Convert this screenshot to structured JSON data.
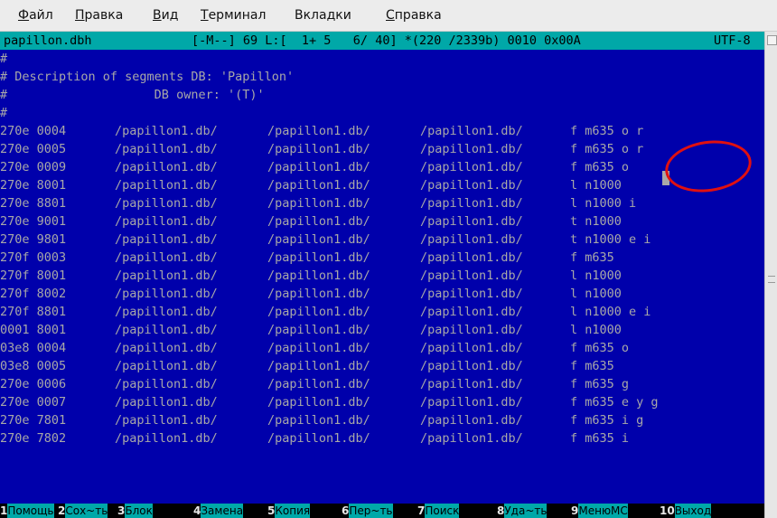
{
  "menu": [
    {
      "label": "Файл",
      "underline": "Ф",
      "rest": "айл"
    },
    {
      "label": "Правка",
      "underline": "П",
      "rest": "равка"
    },
    {
      "label": "Вид",
      "underline": "В",
      "rest": "ид"
    },
    {
      "label": "Терминал",
      "underline": "Т",
      "rest": "ерминал"
    },
    {
      "label": "Вкладки",
      "underline": "",
      "rest": "Вкладки"
    },
    {
      "label": "Справка",
      "underline": "С",
      "rest": "правка"
    }
  ],
  "status": {
    "filename": "papillon.dbh",
    "mode": "[-M--] 69 L:[  1+ 5   6/ 40] *(220 /2339b) 0010 0x00A",
    "encoding": "UTF-8"
  },
  "header_lines": [
    "#",
    "# Description of segments DB: 'Papillon'",
    "#                    DB owner: '(T)'",
    "#"
  ],
  "rows": [
    {
      "id": "270e 0004",
      "p1": "/papillon1.db/",
      "p2": "/papillon1.db/",
      "p3": "/papillon1.db/",
      "attr": "f m635 o r"
    },
    {
      "id": "270e 0005",
      "p1": "/papillon1.db/",
      "p2": "/papillon1.db/",
      "p3": "/papillon1.db/",
      "attr": "f m635 o r"
    },
    {
      "id": "270e 0009",
      "p1": "/papillon1.db/",
      "p2": "/papillon1.db/",
      "p3": "/papillon1.db/",
      "attr": "f m635 o"
    },
    {
      "id": "270e 8001",
      "p1": "/papillon1.db/",
      "p2": "/papillon1.db/",
      "p3": "/papillon1.db/",
      "attr": "l n1000"
    },
    {
      "id": "270e 8801",
      "p1": "/papillon1.db/",
      "p2": "/papillon1.db/",
      "p3": "/papillon1.db/",
      "attr": "l n1000 i"
    },
    {
      "id": "270e 9001",
      "p1": "/papillon1.db/",
      "p2": "/papillon1.db/",
      "p3": "/papillon1.db/",
      "attr": "t n1000"
    },
    {
      "id": "270e 9801",
      "p1": "/papillon1.db/",
      "p2": "/papillon1.db/",
      "p3": "/papillon1.db/",
      "attr": "t n1000 e i"
    },
    {
      "id": "270f 0003",
      "p1": "/papillon1.db/",
      "p2": "/papillon1.db/",
      "p3": "/papillon1.db/",
      "attr": "f m635"
    },
    {
      "id": "270f 8001",
      "p1": "/papillon1.db/",
      "p2": "/papillon1.db/",
      "p3": "/papillon1.db/",
      "attr": "l n1000"
    },
    {
      "id": "270f 8002",
      "p1": "/papillon1.db/",
      "p2": "/papillon1.db/",
      "p3": "/papillon1.db/",
      "attr": "l n1000"
    },
    {
      "id": "270f 8801",
      "p1": "/papillon1.db/",
      "p2": "/papillon1.db/",
      "p3": "/papillon1.db/",
      "attr": "l n1000 e i"
    },
    {
      "id": "0001 8001",
      "p1": "/papillon1.db/",
      "p2": "/papillon1.db/",
      "p3": "/papillon1.db/",
      "attr": "l n1000"
    },
    {
      "id": "03e8 0004",
      "p1": "/papillon1.db/",
      "p2": "/papillon1.db/",
      "p3": "/papillon1.db/",
      "attr": "f m635 o"
    },
    {
      "id": "03e8 0005",
      "p1": "/papillon1.db/",
      "p2": "/papillon1.db/",
      "p3": "/papillon1.db/",
      "attr": "f m635"
    },
    {
      "id": "270e 0006",
      "p1": "/papillon1.db/",
      "p2": "/papillon1.db/",
      "p3": "/papillon1.db/",
      "attr": "f m635 g"
    },
    {
      "id": "270e 0007",
      "p1": "/papillon1.db/",
      "p2": "/papillon1.db/",
      "p3": "/papillon1.db/",
      "attr": "f m635 e y g"
    },
    {
      "id": "270e 7801",
      "p1": "/papillon1.db/",
      "p2": "/papillon1.db/",
      "p3": "/papillon1.db/",
      "attr": "f m635 i g"
    },
    {
      "id": "270e 7802",
      "p1": "/papillon1.db/",
      "p2": "/papillon1.db/",
      "p3": "/papillon1.db/",
      "attr": "f m635 i"
    }
  ],
  "fkeys": [
    {
      "num": "1",
      "label": "Помощь"
    },
    {
      "num": "2",
      "label": "Сох~ть"
    },
    {
      "num": "3",
      "label": "Блок"
    },
    {
      "num": "4",
      "label": "Замена"
    },
    {
      "num": "5",
      "label": "Копия"
    },
    {
      "num": "6",
      "label": "Пер~ть"
    },
    {
      "num": "7",
      "label": "Поиск"
    },
    {
      "num": "8",
      "label": "Уда~ть"
    },
    {
      "num": "9",
      "label": "МенюМС"
    },
    {
      "num": "10",
      "label": "Выход"
    }
  ],
  "colors": {
    "background": "#0000ab",
    "text": "#a8a8a8",
    "status_bar": "#00a8a8",
    "annotation": "#e01010"
  }
}
